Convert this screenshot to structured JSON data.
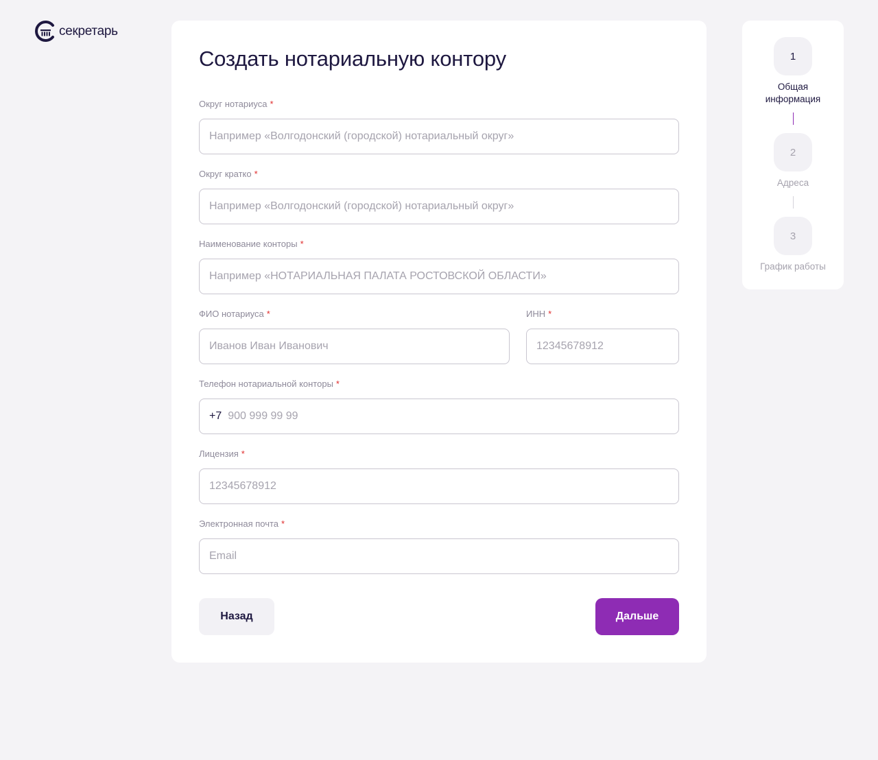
{
  "brand": {
    "name": "секретарь"
  },
  "form": {
    "title": "Создать нотариальную контору",
    "required_mark": "*",
    "fields": {
      "district": {
        "label": "Округ нотариуса",
        "placeholder": "Например «Волгодонский (городской) нотариальный округ»"
      },
      "district_short": {
        "label": "Округ кратко",
        "placeholder": "Например «Волгодонский (городской) нотариальный округ»"
      },
      "office_name": {
        "label": "Наименование конторы",
        "placeholder": "Например «НОТАРИАЛЬНАЯ ПАЛАТА РОСТОВСКОЙ ОБЛАСТИ»"
      },
      "notary_name": {
        "label": "ФИО нотариуса",
        "placeholder": "Иванов Иван Иванович"
      },
      "inn": {
        "label": "ИНН",
        "placeholder": "12345678912"
      },
      "phone": {
        "label": "Телефон нотариальной конторы",
        "prefix": "+7",
        "placeholder": "900 999 99 99"
      },
      "license": {
        "label": "Лицензия",
        "placeholder": "12345678912"
      },
      "email": {
        "label": "Электронная почта",
        "placeholder": "Email"
      }
    },
    "buttons": {
      "back": "Назад",
      "next": "Дальше"
    }
  },
  "stepper": {
    "current": 1,
    "steps": [
      {
        "number": "1",
        "label_line1": "Общая",
        "label_line2": "информация"
      },
      {
        "number": "2",
        "label": "Адреса"
      },
      {
        "number": "3",
        "label": "График работы"
      }
    ]
  },
  "colors": {
    "background": "#f4f3f6",
    "accent": "#8e2cb4",
    "text_dark": "#1e1840",
    "required": "#e02e2e",
    "placeholder": "#a6a3ae"
  }
}
